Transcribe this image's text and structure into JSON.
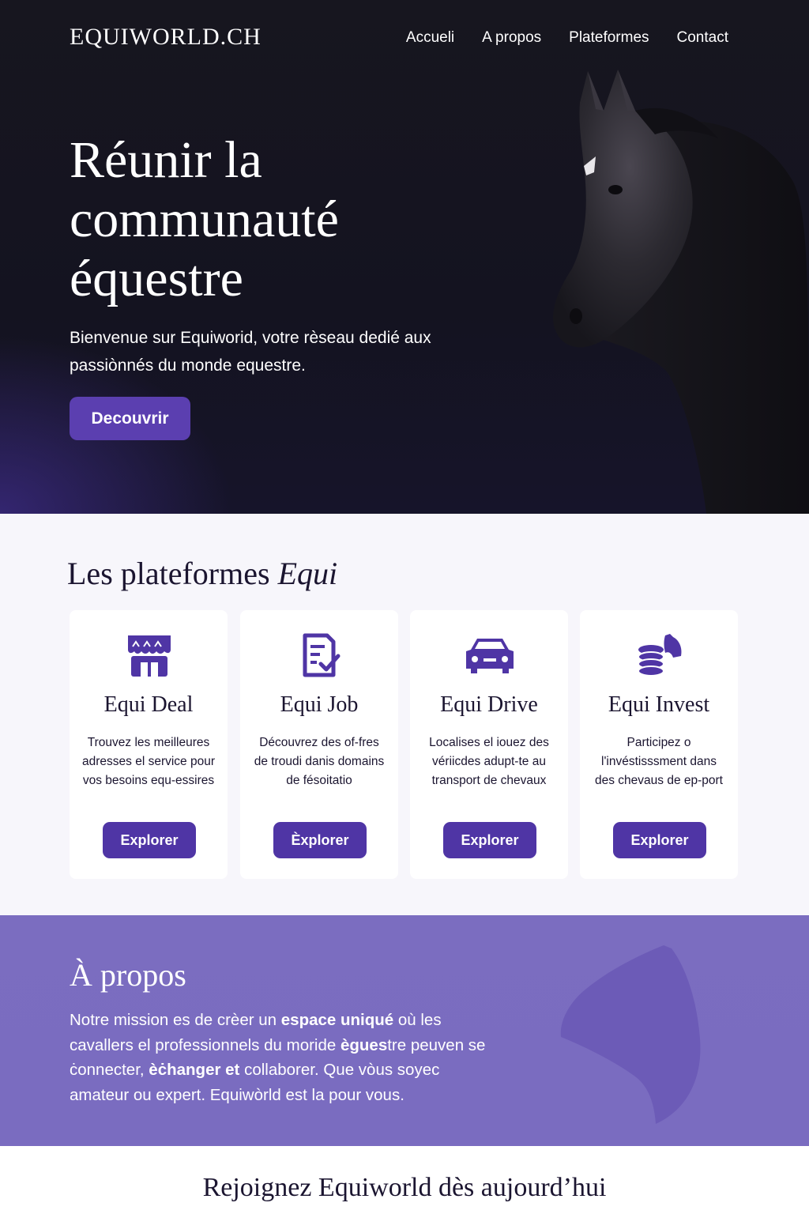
{
  "header": {
    "brand": "EQUIWORLD.CH",
    "nav": [
      "Accueli",
      "A propos",
      "Plateformes",
      "Contact"
    ]
  },
  "hero": {
    "title": "Réunir la communauté équestre",
    "subtitle": "Bienvenue sur Equiworid, votre rèseau dedié aux passiònnés du monde equestre.",
    "cta": "Decouvrir"
  },
  "platforms": {
    "title_main": "Les plateformes ",
    "title_em": "Equi",
    "cards": [
      {
        "title": "Equi Deal",
        "desc": "Trouvez les meilleures adresses el service pour vos besoins equ-essires",
        "button": "Explorer",
        "icon": "storefront-icon"
      },
      {
        "title": "Equi Job",
        "desc": "Découvrez des of-fres de troudi danis domains de fésoitatio",
        "button": "Èxplorer",
        "icon": "checklist-icon"
      },
      {
        "title": "Equi Drive",
        "desc": "Localises el iouez des vériicdes adupt-te au transport de chevaux",
        "button": "Explorer",
        "icon": "car-icon"
      },
      {
        "title": "Equi Invest",
        "desc": "Participez o l'invéstisssment dans des chevaus de ep-port",
        "button": "Explorer",
        "icon": "coins-horse-icon"
      }
    ]
  },
  "about": {
    "title": "À propos",
    "text_parts": [
      "Notre mission es de crèer un ",
      "espace uniqué",
      " où les cavallers el professionnels du moride ",
      "ègues",
      "tre peuven se ċonnecter, ",
      "èċhanger et",
      " collaborer. Que vòus soyec amateur ou expert. Equiwòrld est la pour vous."
    ]
  },
  "join": {
    "title": "Rejoignez Equiworld dès aujourd’hui"
  },
  "colors": {
    "accent": "#5b3fb0",
    "button": "#4f35a5",
    "about_bg": "#7b6dc0",
    "hero_bg": "#16151f"
  }
}
